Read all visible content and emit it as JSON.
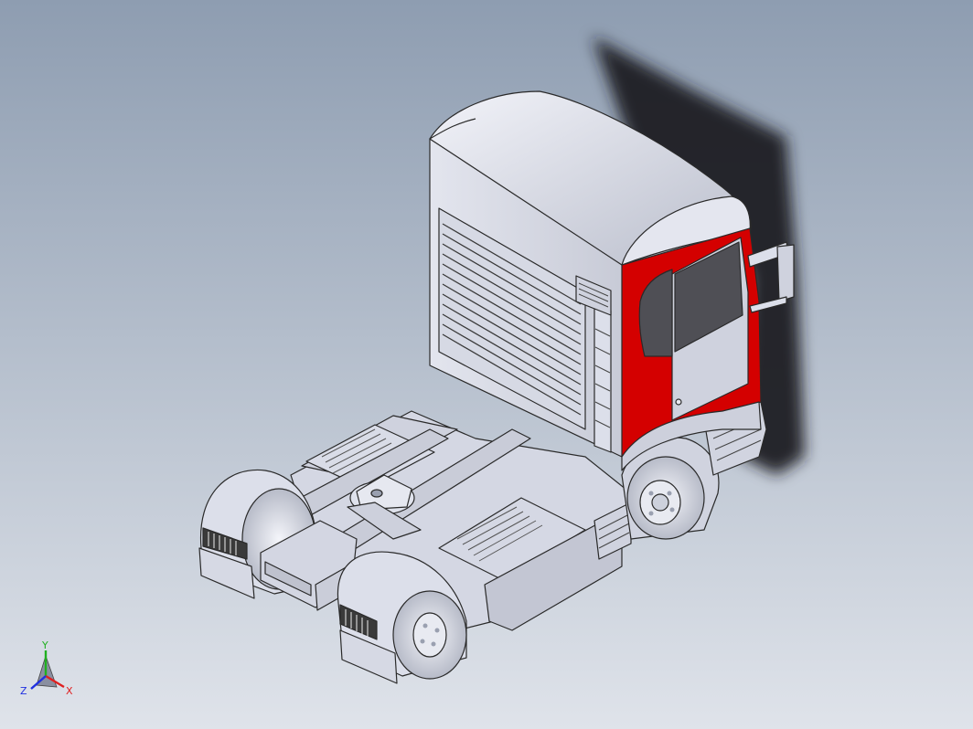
{
  "viewport": {
    "background": {
      "top_color": "#8e9db1",
      "bottom_color": "#dfe3ea"
    },
    "model": {
      "name": "truck-tractor",
      "body_color": "#dadde9",
      "edge_color": "#2a2a2a",
      "accent_color": "#d40000",
      "glass_color": "#4f4f55",
      "shadow_color": "#1e2024"
    }
  },
  "triad": {
    "x_label": "X",
    "y_label": "Y",
    "z_label": "Z",
    "x_color": "#e02020",
    "y_color": "#20b020",
    "z_color": "#2030e0"
  }
}
